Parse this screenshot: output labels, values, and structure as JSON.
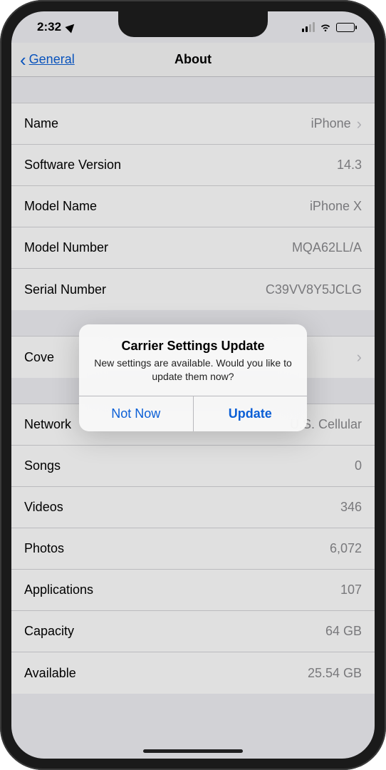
{
  "status_bar": {
    "time": "2:32"
  },
  "nav": {
    "back_label": "General",
    "title": "About"
  },
  "group1": [
    {
      "label": "Name",
      "value": "iPhone",
      "chevron": true
    },
    {
      "label": "Software Version",
      "value": "14.3"
    },
    {
      "label": "Model Name",
      "value": "iPhone X"
    },
    {
      "label": "Model Number",
      "value": "MQA62LL/A"
    },
    {
      "label": "Serial Number",
      "value": "C39VV8Y5JCLG"
    }
  ],
  "group2": [
    {
      "label": "Cove",
      "value": "",
      "chevron": true
    }
  ],
  "group3": [
    {
      "label": "Network",
      "value": "U.S. Cellular"
    },
    {
      "label": "Songs",
      "value": "0"
    },
    {
      "label": "Videos",
      "value": "346"
    },
    {
      "label": "Photos",
      "value": "6,072"
    },
    {
      "label": "Applications",
      "value": "107"
    },
    {
      "label": "Capacity",
      "value": "64 GB"
    },
    {
      "label": "Available",
      "value": "25.54 GB"
    }
  ],
  "alert": {
    "title": "Carrier Settings Update",
    "message": "New settings are available. Would you like to update them now?",
    "cancel": "Not Now",
    "confirm": "Update"
  }
}
